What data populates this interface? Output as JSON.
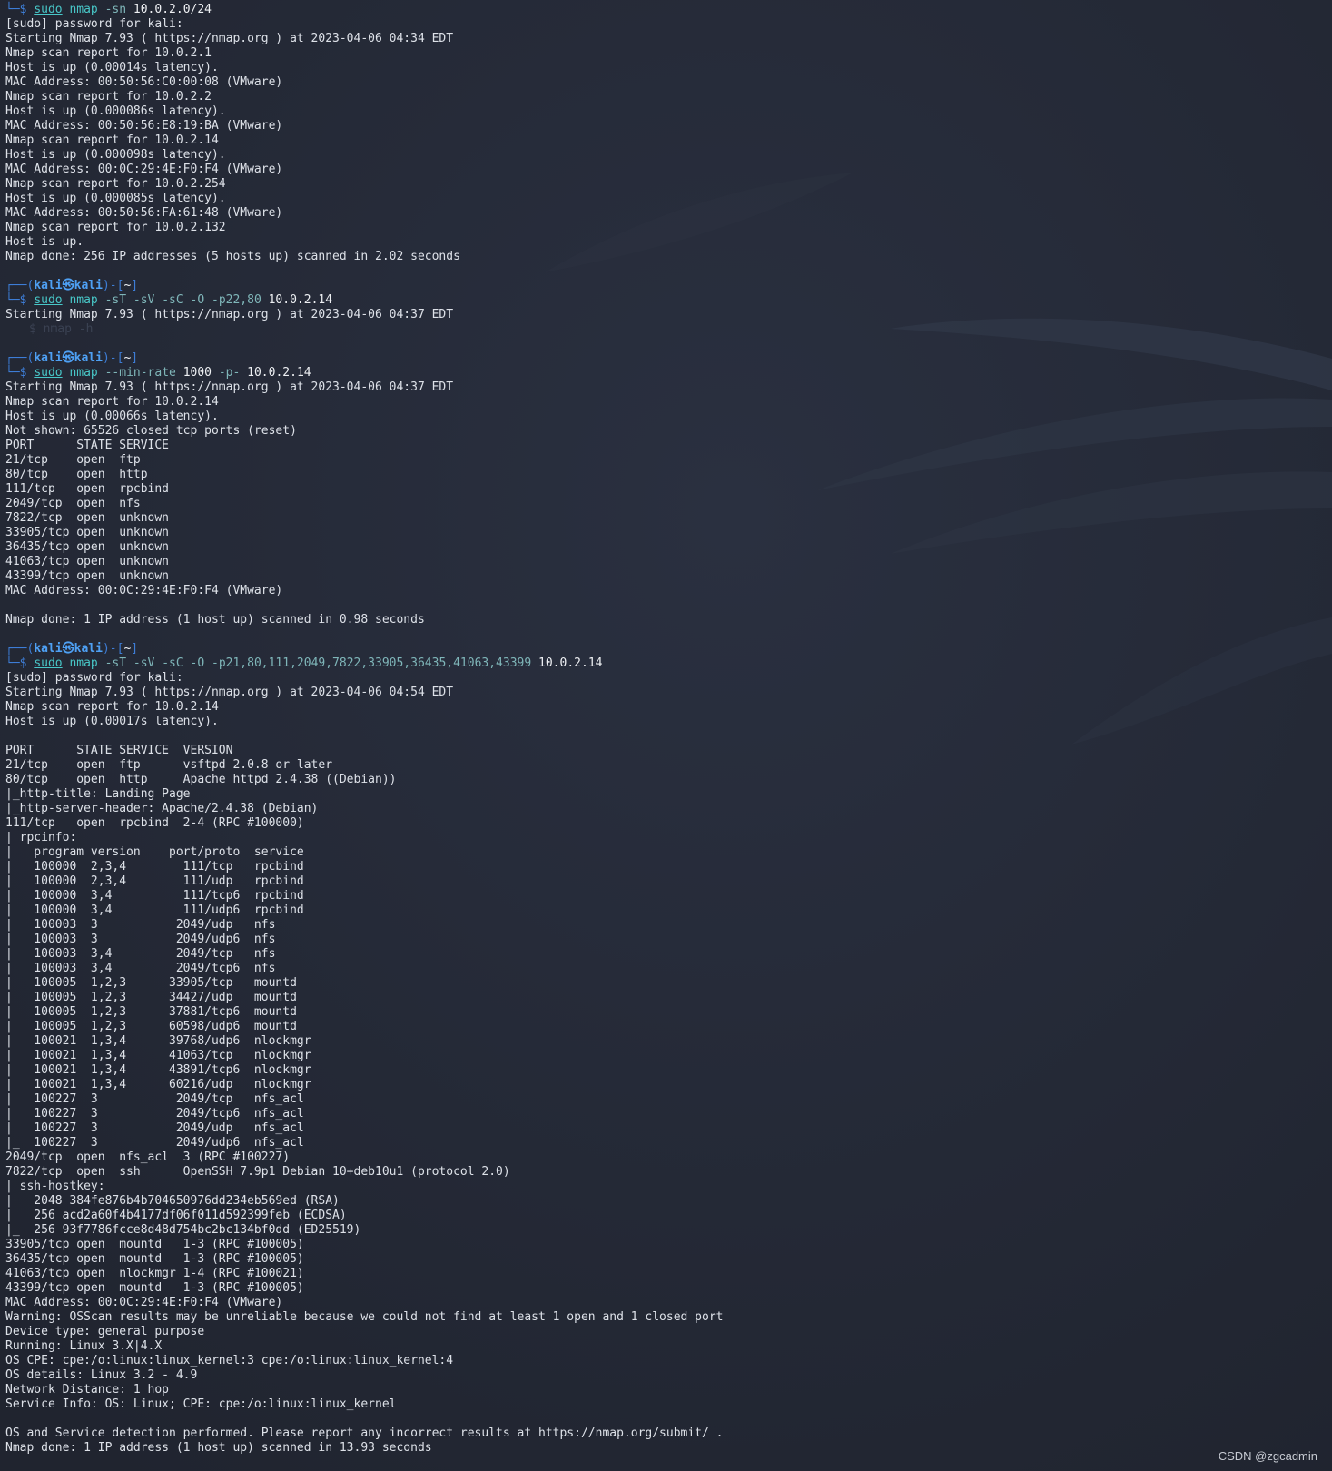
{
  "prompt": {
    "user": "kali",
    "at": "㉿",
    "host": "kali",
    "dir": "~"
  },
  "commands": {
    "c1": {
      "sudo": "sudo",
      "nmap": "nmap",
      "opts": "-sn",
      "target": "10.0.2.0/24"
    },
    "c2": {
      "sudo": "sudo",
      "nmap": "nmap",
      "opts": "-sT -sV -sC -O -p22,80",
      "target": "10.0.2.14"
    },
    "c3": {
      "sudo": "sudo",
      "nmap": "nmap",
      "opt1": "--min-rate",
      "val1": "1000",
      "opt2": "-p-",
      "target": "10.0.2.14"
    },
    "c4": {
      "sudo": "sudo",
      "nmap": "nmap",
      "opts": "-sT -sV -sC -O -p21,80,111,2049,7822,33905,36435,41063,43399",
      "target": "10.0.2.14"
    }
  },
  "ghost_text": "$ nmap -h",
  "block1": [
    "[sudo] password for kali:",
    "Starting Nmap 7.93 ( https://nmap.org ) at 2023-04-06 04:34 EDT",
    "Nmap scan report for 10.0.2.1",
    "Host is up (0.00014s latency).",
    "MAC Address: 00:50:56:C0:00:08 (VMware)",
    "Nmap scan report for 10.0.2.2",
    "Host is up (0.000086s latency).",
    "MAC Address: 00:50:56:E8:19:BA (VMware)",
    "Nmap scan report for 10.0.2.14",
    "Host is up (0.000098s latency).",
    "MAC Address: 00:0C:29:4E:F0:F4 (VMware)",
    "Nmap scan report for 10.0.2.254",
    "Host is up (0.000085s latency).",
    "MAC Address: 00:50:56:FA:61:48 (VMware)",
    "Nmap scan report for 10.0.2.132",
    "Host is up.",
    "Nmap done: 256 IP addresses (5 hosts up) scanned in 2.02 seconds",
    ""
  ],
  "block2": [
    "Starting Nmap 7.93 ( https://nmap.org ) at 2023-04-06 04:37 EDT"
  ],
  "block3": [
    "Starting Nmap 7.93 ( https://nmap.org ) at 2023-04-06 04:37 EDT",
    "Nmap scan report for 10.0.2.14",
    "Host is up (0.00066s latency).",
    "Not shown: 65526 closed tcp ports (reset)",
    "PORT      STATE SERVICE",
    "21/tcp    open  ftp",
    "80/tcp    open  http",
    "111/tcp   open  rpcbind",
    "2049/tcp  open  nfs",
    "7822/tcp  open  unknown",
    "33905/tcp open  unknown",
    "36435/tcp open  unknown",
    "41063/tcp open  unknown",
    "43399/tcp open  unknown",
    "MAC Address: 00:0C:29:4E:F0:F4 (VMware)",
    "",
    "Nmap done: 1 IP address (1 host up) scanned in 0.98 seconds",
    ""
  ],
  "block4": [
    "[sudo] password for kali:",
    "Starting Nmap 7.93 ( https://nmap.org ) at 2023-04-06 04:54 EDT",
    "Nmap scan report for 10.0.2.14",
    "Host is up (0.00017s latency).",
    "",
    "PORT      STATE SERVICE  VERSION",
    "21/tcp    open  ftp      vsftpd 2.0.8 or later",
    "80/tcp    open  http     Apache httpd 2.4.38 ((Debian))",
    "|_http-title: Landing Page",
    "|_http-server-header: Apache/2.4.38 (Debian)",
    "111/tcp   open  rpcbind  2-4 (RPC #100000)",
    "| rpcinfo:",
    "|   program version    port/proto  service",
    "|   100000  2,3,4        111/tcp   rpcbind",
    "|   100000  2,3,4        111/udp   rpcbind",
    "|   100000  3,4          111/tcp6  rpcbind",
    "|   100000  3,4          111/udp6  rpcbind",
    "|   100003  3           2049/udp   nfs",
    "|   100003  3           2049/udp6  nfs",
    "|   100003  3,4         2049/tcp   nfs",
    "|   100003  3,4         2049/tcp6  nfs",
    "|   100005  1,2,3      33905/tcp   mountd",
    "|   100005  1,2,3      34427/udp   mountd",
    "|   100005  1,2,3      37881/tcp6  mountd",
    "|   100005  1,2,3      60598/udp6  mountd",
    "|   100021  1,3,4      39768/udp6  nlockmgr",
    "|   100021  1,3,4      41063/tcp   nlockmgr",
    "|   100021  1,3,4      43891/tcp6  nlockmgr",
    "|   100021  1,3,4      60216/udp   nlockmgr",
    "|   100227  3           2049/tcp   nfs_acl",
    "|   100227  3           2049/tcp6  nfs_acl",
    "|   100227  3           2049/udp   nfs_acl",
    "|_  100227  3           2049/udp6  nfs_acl",
    "2049/tcp  open  nfs_acl  3 (RPC #100227)",
    "7822/tcp  open  ssh      OpenSSH 7.9p1 Debian 10+deb10u1 (protocol 2.0)",
    "| ssh-hostkey:",
    "|   2048 384fe876b4b704650976dd234eb569ed (RSA)",
    "|   256 acd2a60f4b4177df06f011d592399feb (ECDSA)",
    "|_  256 93f7786fcce8d48d754bc2bc134bf0dd (ED25519)",
    "33905/tcp open  mountd   1-3 (RPC #100005)",
    "36435/tcp open  mountd   1-3 (RPC #100005)",
    "41063/tcp open  nlockmgr 1-4 (RPC #100021)",
    "43399/tcp open  mountd   1-3 (RPC #100005)",
    "MAC Address: 00:0C:29:4E:F0:F4 (VMware)",
    "Warning: OSScan results may be unreliable because we could not find at least 1 open and 1 closed port",
    "Device type: general purpose",
    "Running: Linux 3.X|4.X",
    "OS CPE: cpe:/o:linux:linux_kernel:3 cpe:/o:linux:linux_kernel:4",
    "OS details: Linux 3.2 - 4.9",
    "Network Distance: 1 hop",
    "Service Info: OS: Linux; CPE: cpe:/o:linux:linux_kernel",
    "",
    "OS and Service detection performed. Please report any incorrect results at https://nmap.org/submit/ .",
    "Nmap done: 1 IP address (1 host up) scanned in 13.93 seconds"
  ],
  "watermark": "CSDN @zgcadmin"
}
